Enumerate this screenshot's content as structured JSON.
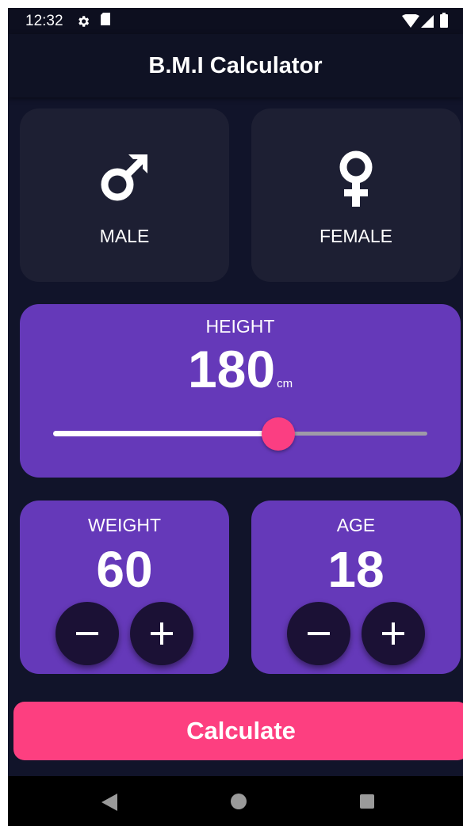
{
  "status_bar": {
    "time": "12:32",
    "icons": [
      "gear-icon",
      "sd-card-icon",
      "wifi-icon",
      "signal-icon",
      "battery-icon"
    ]
  },
  "app_bar": {
    "title": "B.M.I Calculator"
  },
  "gender": {
    "male": {
      "label": "MALE",
      "icon": "male-symbol-icon"
    },
    "female": {
      "label": "FEMALE",
      "icon": "female-symbol-icon"
    }
  },
  "height": {
    "label": "HEIGHT",
    "value": "180",
    "unit": "cm",
    "slider_fraction": 0.6
  },
  "weight": {
    "label": "WEIGHT",
    "value": "60"
  },
  "age": {
    "label": "AGE",
    "value": "18"
  },
  "calculate": {
    "label": "Calculate"
  },
  "colors": {
    "background": "#11142a",
    "inactive_card": "#1d1f33",
    "active_card": "#6539b9",
    "accent": "#fd3f80",
    "round_button": "#1b1135"
  },
  "nav_bar": {
    "icons": [
      "back-icon",
      "home-icon",
      "recents-icon"
    ]
  }
}
